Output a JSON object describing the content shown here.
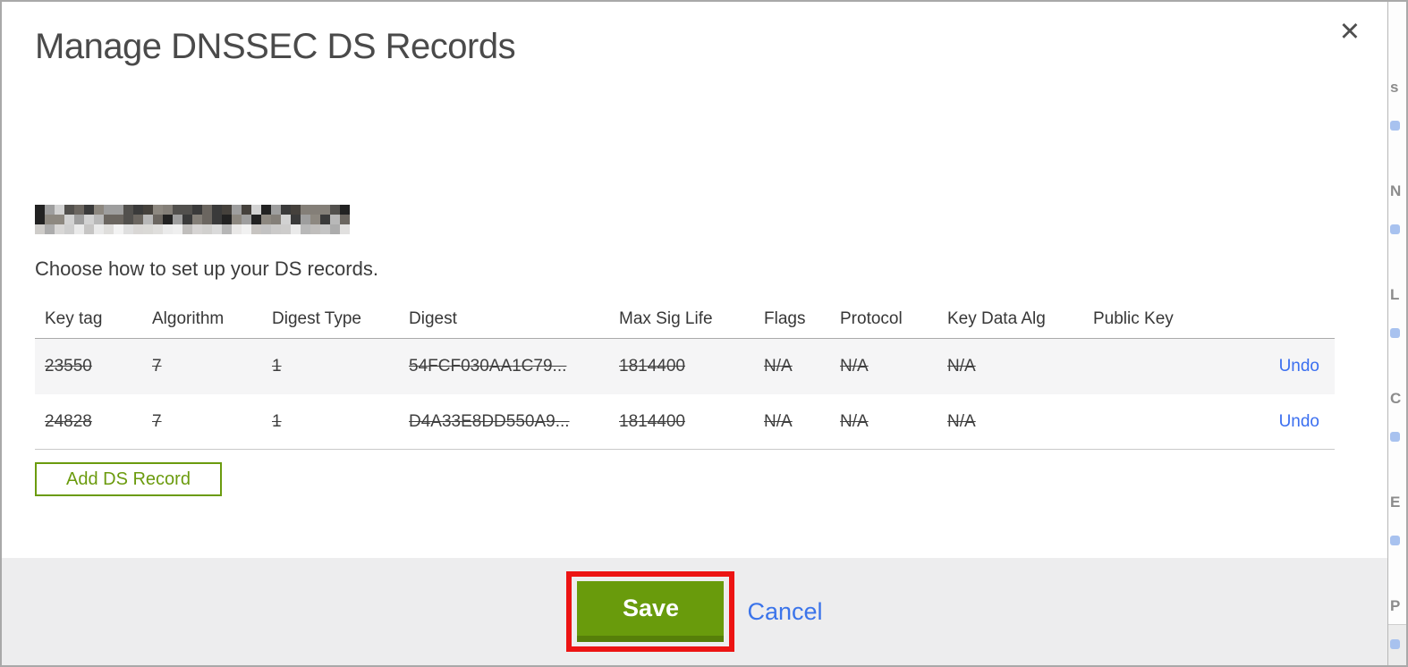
{
  "modal": {
    "title": "Manage DNSSEC DS Records",
    "close_icon": "✕",
    "domain_redacted": true,
    "subtitle": "Choose how to set up your DS records.",
    "table": {
      "columns": [
        "Key tag",
        "Algorithm",
        "Digest Type",
        "Digest",
        "Max Sig Life",
        "Flags",
        "Protocol",
        "Key Data Alg",
        "Public Key"
      ],
      "rows": [
        {
          "key_tag": "23550",
          "algorithm": "7",
          "digest_type": "1",
          "digest": "54FCF030AA1C79...",
          "max_sig_life": "1814400",
          "flags": "N/A",
          "protocol": "N/A",
          "key_data_alg": "N/A",
          "public_key": "",
          "action": "Undo",
          "struck": true
        },
        {
          "key_tag": "24828",
          "algorithm": "7",
          "digest_type": "1",
          "digest": "D4A33E8DD550A9...",
          "max_sig_life": "1814400",
          "flags": "N/A",
          "protocol": "N/A",
          "key_data_alg": "N/A",
          "public_key": "",
          "action": "Undo",
          "struck": true
        }
      ]
    },
    "add_button_label": "Add DS Record",
    "footer": {
      "save_label": "Save",
      "cancel_label": "Cancel"
    }
  },
  "background_strip": {
    "letter_fragments": [
      "s",
      "N",
      "L",
      "C",
      "E",
      "P"
    ]
  },
  "colors": {
    "accent_green": "#699b0c",
    "accent_green_dark": "#567f09",
    "link_blue": "#3b6ff0",
    "annotation_red": "#ec1413",
    "footer_gray": "#ededee",
    "row_alt_gray": "#f5f5f6"
  }
}
